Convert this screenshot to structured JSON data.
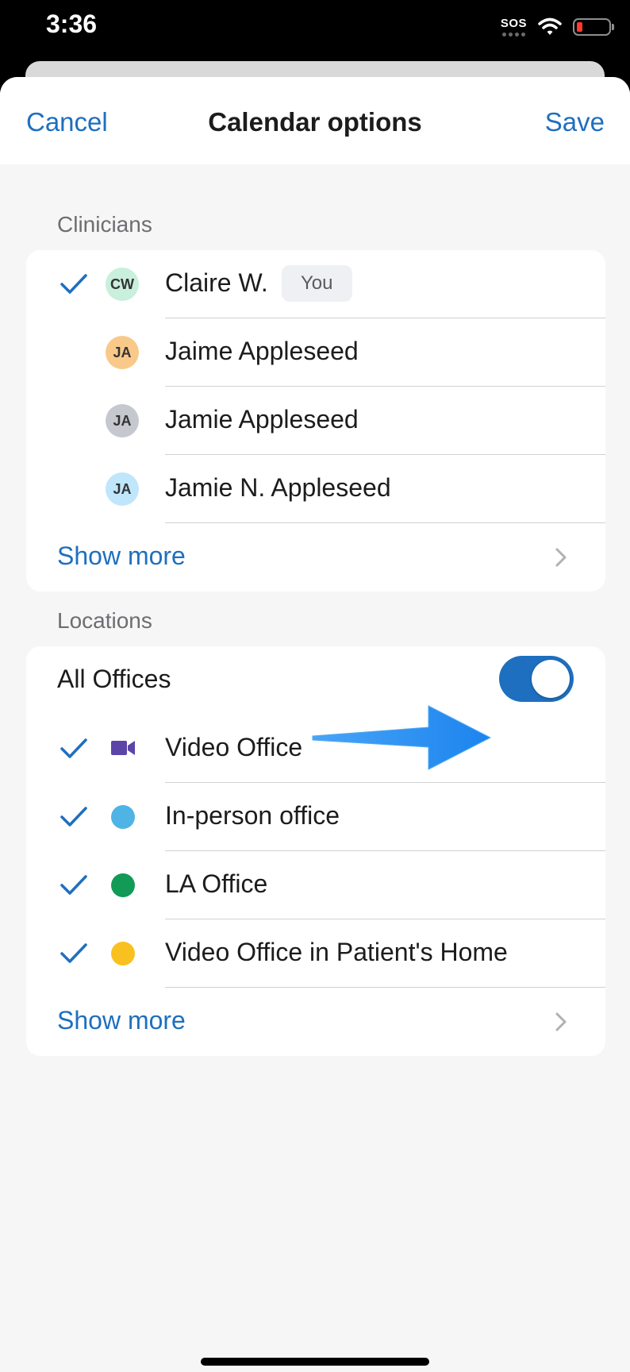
{
  "status_bar": {
    "time": "3:36",
    "sos_label": "SOS",
    "battery_color": "#ff3b30"
  },
  "nav": {
    "cancel_label": "Cancel",
    "title": "Calendar options",
    "save_label": "Save"
  },
  "clinicians": {
    "header": "Clinicians",
    "items": [
      {
        "initials": "CW",
        "name": "Claire W.",
        "badge": "You",
        "checked": true,
        "avatar_color": "#c9efdd"
      },
      {
        "initials": "JA",
        "name": "Jaime Appleseed",
        "checked": false,
        "avatar_color": "#f9c98a"
      },
      {
        "initials": "JA",
        "name": "Jamie Appleseed",
        "checked": false,
        "avatar_color": "#c5c8ce"
      },
      {
        "initials": "JA",
        "name": "Jamie N. Appleseed",
        "checked": false,
        "avatar_color": "#bfe6fb"
      }
    ],
    "show_more_label": "Show more"
  },
  "locations": {
    "header": "Locations",
    "all_offices_label": "All Offices",
    "all_offices_enabled": true,
    "items": [
      {
        "name": "Video Office",
        "icon": "video-camera-icon",
        "color": "#5b45a8",
        "checked": true
      },
      {
        "name": "In-person office",
        "icon": "dot",
        "color": "#4fb3e6",
        "checked": true
      },
      {
        "name": "LA Office",
        "icon": "dot",
        "color": "#129a57",
        "checked": true
      },
      {
        "name": "Video Office in Patient's Home",
        "icon": "dot",
        "color": "#f9c11f",
        "checked": true
      }
    ],
    "show_more_label": "Show more"
  },
  "colors": {
    "accent": "#1e6fbf",
    "annotation_arrow": "#2b8ff2"
  }
}
